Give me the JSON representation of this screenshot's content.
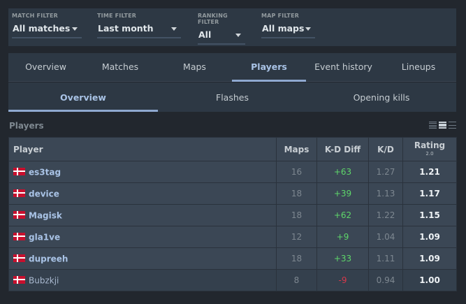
{
  "filters": [
    {
      "label": "MATCH FILTER",
      "value": "All matches"
    },
    {
      "label": "TIME FILTER",
      "value": "Last month"
    },
    {
      "label": "RANKING FILTER",
      "value": "All"
    },
    {
      "label": "MAP FILTER",
      "value": "All maps"
    }
  ],
  "main_tabs": [
    "Overview",
    "Matches",
    "Maps",
    "Players",
    "Event history",
    "Lineups"
  ],
  "main_tabs_active": "Players",
  "sub_tabs": [
    "Overview",
    "Flashes",
    "Opening kills"
  ],
  "sub_tabs_active": "Overview",
  "section_title": "Players",
  "table": {
    "headers": {
      "player": "Player",
      "maps": "Maps",
      "kd_diff": "K-D Diff",
      "kd": "K/D",
      "rating": "Rating",
      "rating_sub": "2.0"
    },
    "rows": [
      {
        "player": "es3tag",
        "country": "Denmark",
        "maps": "16",
        "kd_diff": "+63",
        "kd": "1.27",
        "rating": "1.21"
      },
      {
        "player": "device",
        "country": "Denmark",
        "maps": "18",
        "kd_diff": "+39",
        "kd": "1.13",
        "rating": "1.17"
      },
      {
        "player": "Magisk",
        "country": "Denmark",
        "maps": "18",
        "kd_diff": "+62",
        "kd": "1.22",
        "rating": "1.15"
      },
      {
        "player": "gla1ve",
        "country": "Denmark",
        "maps": "12",
        "kd_diff": "+9",
        "kd": "1.04",
        "rating": "1.09"
      },
      {
        "player": "dupreeh",
        "country": "Denmark",
        "maps": "18",
        "kd_diff": "+33",
        "kd": "1.11",
        "rating": "1.09"
      },
      {
        "player": "Bubzkji",
        "country": "Denmark",
        "maps": "8",
        "kd_diff": "-9",
        "kd": "0.94",
        "rating": "1.00"
      }
    ]
  },
  "colors": {
    "positive": "#5ed66a",
    "negative": "#d6384b",
    "accent": "#8fa9d0"
  }
}
